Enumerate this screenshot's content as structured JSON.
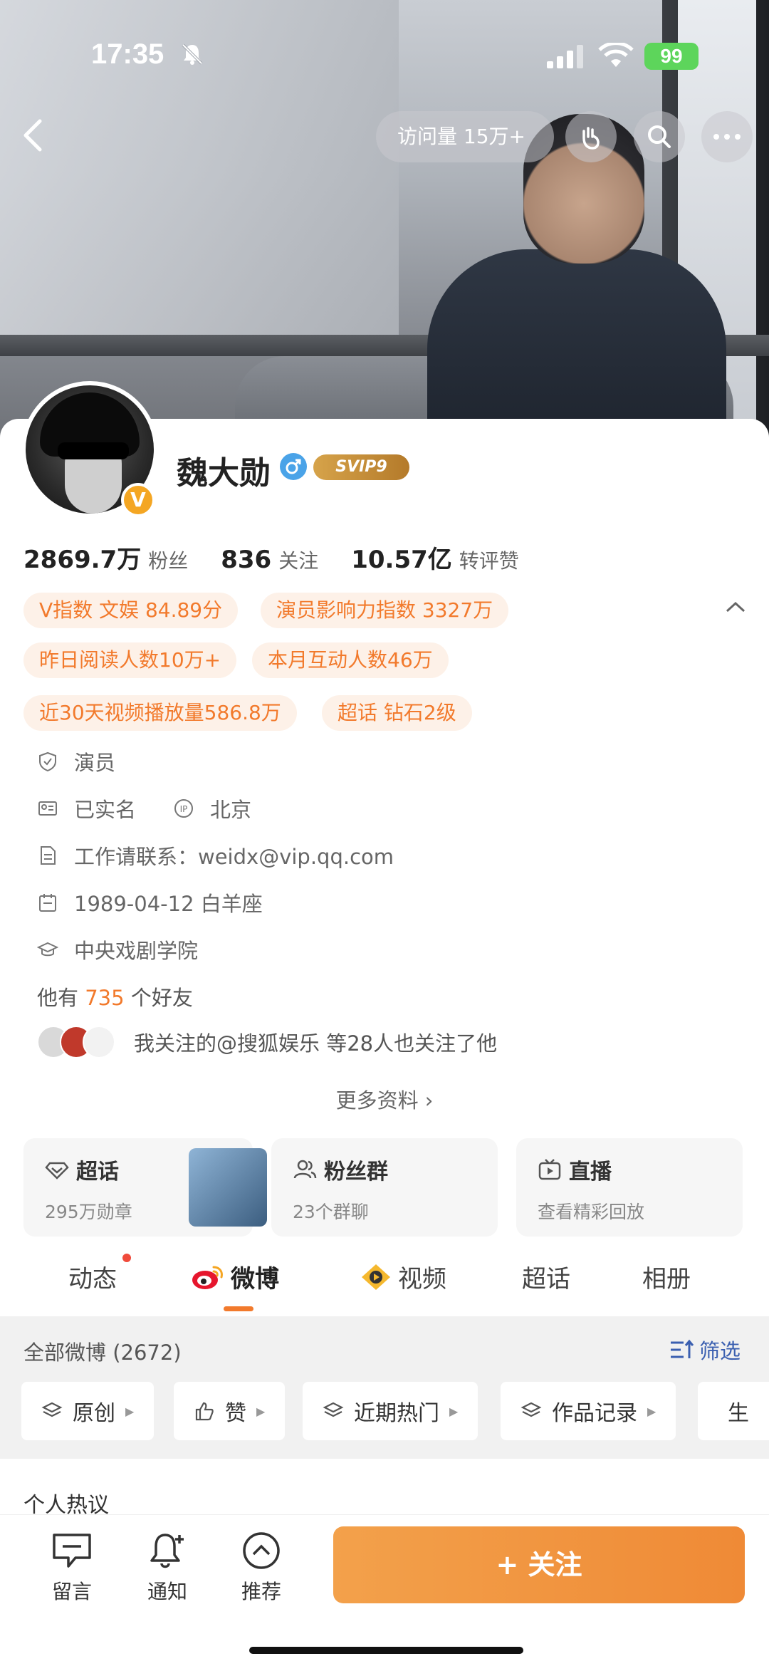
{
  "status_bar": {
    "time": "17:35",
    "battery": "99"
  },
  "header": {
    "visit_label": "访问量 15万+"
  },
  "profile": {
    "name": "魏大勋",
    "svip": "SVIP9",
    "verified_badge": "V",
    "stats": [
      {
        "value": "2869.7万",
        "label": "粉丝"
      },
      {
        "value": "836",
        "label": "关注"
      },
      {
        "value": "10.57亿",
        "label": "转评赞"
      }
    ],
    "tags": [
      "V指数 文娱 84.89分",
      "演员影响力指数 3327万",
      "昨日阅读人数10万+",
      "本月互动人数46万",
      "近30天视频播放量586.8万",
      "超话 钻石2级"
    ],
    "info": {
      "occupation": "演员",
      "real_name": "已实名",
      "ip": "北京",
      "contact": "工作请联系：weidx@vip.qq.com",
      "birthday": "1989-04-12 白羊座",
      "school": "中央戏剧学院"
    },
    "friends_prefix": "他有",
    "friends_count": "735",
    "friends_suffix": "个好友",
    "mutual_follow": "我关注的@搜狐娱乐  等28人也关注了他",
    "more_info": "更多资料 ›"
  },
  "features": [
    {
      "title": "超话",
      "sub": "295万勋章"
    },
    {
      "title": "粉丝群",
      "sub": "23个群聊"
    },
    {
      "title": "直播",
      "sub": "查看精彩回放"
    }
  ],
  "tabs": [
    "动态",
    "微博",
    "视频",
    "超话",
    "相册"
  ],
  "feed": {
    "all_label": "全部微博 (2672)",
    "filter_label": "筛选",
    "chips": [
      "原创",
      "赞",
      "近期热门",
      "作品记录",
      "生"
    ],
    "hot_label": "个人热议"
  },
  "bottom_bar": {
    "items": [
      "留言",
      "通知",
      "推荐"
    ],
    "follow_label": "+ 关注"
  },
  "colors": {
    "accent": "#f27a2c",
    "tag_bg": "#fdf1e8",
    "link": "#3a5fb0"
  }
}
